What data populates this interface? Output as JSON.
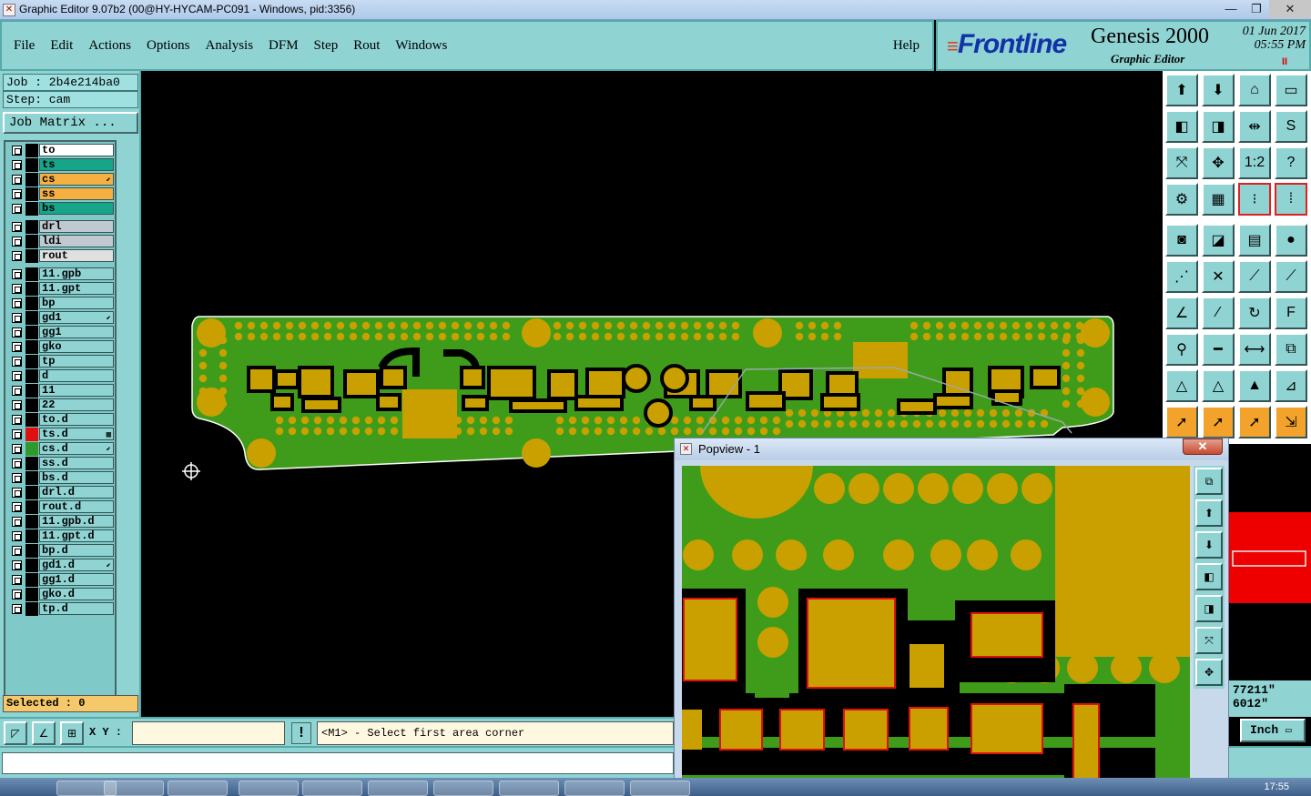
{
  "window": {
    "title": "Graphic Editor 9.07b2 (00@HY-HYCAM-PC091 - Windows, pid:3356)",
    "minimize": "—",
    "maximize": "❐",
    "close": "✕"
  },
  "menu": {
    "items": [
      "File",
      "Edit",
      "Actions",
      "Options",
      "Analysis",
      "DFM",
      "Step",
      "Rout",
      "Windows"
    ],
    "help": "Help"
  },
  "brand": {
    "logo": "Frontline",
    "product": "Genesis 2000",
    "subtitle": "Graphic Editor",
    "date": "01 Jun 2017",
    "time": "05:55 PM",
    "pause": "II"
  },
  "job": {
    "job_line": "Job : 2b4e214ba0",
    "step_line": "Step: cam",
    "matrix_button": "Job Matrix ..."
  },
  "layers": [
    {
      "name": "to",
      "color": "#ffffff",
      "swatch": "#000000",
      "mark": ""
    },
    {
      "name": "ts",
      "color": "#17a589",
      "swatch": "#000000",
      "mark": ""
    },
    {
      "name": "cs",
      "color": "#f5b041",
      "swatch": "#000000",
      "mark": "⬋"
    },
    {
      "name": "ss",
      "color": "#f5b041",
      "swatch": "#000000",
      "mark": ""
    },
    {
      "name": "bs",
      "color": "#17a589",
      "swatch": "#000000",
      "mark": ""
    },
    {
      "name": "drl",
      "color": "#c0c8d0",
      "swatch": "#000000",
      "mark": ""
    },
    {
      "name": "ldi",
      "color": "#c0c8d0",
      "swatch": "#000000",
      "mark": ""
    },
    {
      "name": "rout",
      "color": "#e0e0e0",
      "swatch": "#000000",
      "mark": ""
    },
    {
      "name": "11.gpb",
      "color": "#8fd3d3",
      "swatch": "#000000",
      "mark": ""
    },
    {
      "name": "11.gpt",
      "color": "#8fd3d3",
      "swatch": "#000000",
      "mark": ""
    },
    {
      "name": "bp",
      "color": "#8fd3d3",
      "swatch": "#000000",
      "mark": ""
    },
    {
      "name": "gd1",
      "color": "#8fd3d3",
      "swatch": "#000000",
      "mark": "⬋"
    },
    {
      "name": "gg1",
      "color": "#8fd3d3",
      "swatch": "#000000",
      "mark": ""
    },
    {
      "name": "gko",
      "color": "#8fd3d3",
      "swatch": "#000000",
      "mark": ""
    },
    {
      "name": "tp",
      "color": "#8fd3d3",
      "swatch": "#000000",
      "mark": ""
    },
    {
      "name": "d",
      "color": "#8fd3d3",
      "swatch": "#000000",
      "mark": ""
    },
    {
      "name": "11",
      "color": "#8fd3d3",
      "swatch": "#000000",
      "mark": ""
    },
    {
      "name": "22",
      "color": "#8fd3d3",
      "swatch": "#000000",
      "mark": ""
    },
    {
      "name": "to.d",
      "color": "#8fd3d3",
      "swatch": "#000000",
      "mark": ""
    },
    {
      "name": "ts.d",
      "color": "#8fd3d3",
      "swatch": "#e01010",
      "mark": "▦"
    },
    {
      "name": "cs.d",
      "color": "#8fd3d3",
      "swatch": "#2e9a2e",
      "mark": "⬋"
    },
    {
      "name": "ss.d",
      "color": "#8fd3d3",
      "swatch": "#000000",
      "mark": ""
    },
    {
      "name": "bs.d",
      "color": "#8fd3d3",
      "swatch": "#000000",
      "mark": ""
    },
    {
      "name": "drl.d",
      "color": "#8fd3d3",
      "swatch": "#000000",
      "mark": ""
    },
    {
      "name": "rout.d",
      "color": "#8fd3d3",
      "swatch": "#000000",
      "mark": ""
    },
    {
      "name": "11.gpb.d",
      "color": "#8fd3d3",
      "swatch": "#000000",
      "mark": ""
    },
    {
      "name": "11.gpt.d",
      "color": "#8fd3d3",
      "swatch": "#000000",
      "mark": ""
    },
    {
      "name": "bp.d",
      "color": "#8fd3d3",
      "swatch": "#000000",
      "mark": ""
    },
    {
      "name": "gd1.d",
      "color": "#8fd3d3",
      "swatch": "#000000",
      "mark": "⬋"
    },
    {
      "name": "gg1.d",
      "color": "#8fd3d3",
      "swatch": "#000000",
      "mark": ""
    },
    {
      "name": "gko.d",
      "color": "#8fd3d3",
      "swatch": "#000000",
      "mark": ""
    },
    {
      "name": "tp.d",
      "color": "#8fd3d3",
      "swatch": "#000000",
      "mark": ""
    }
  ],
  "selected": "Selected : 0",
  "status": {
    "xy_label": "X Y :",
    "xy_value": "",
    "bang": "!",
    "prompt": "<M1> - Select first area corner"
  },
  "coords": {
    "x": "77211\"",
    "y": "6012\""
  },
  "units": {
    "label": "Inch"
  },
  "popview": {
    "title": "Popview - 1",
    "close": "✕"
  },
  "taskbar": {
    "clock": "17:55"
  },
  "colors": {
    "panel": "#8fd3d3",
    "copper": "#c9a000",
    "mask": "#3f9c1a",
    "accent": "#f3a32c"
  },
  "tools": [
    {
      "icon": "display-layer-icon",
      "glyph": "⬆"
    },
    {
      "icon": "display-layer-down-icon",
      "glyph": "⬇"
    },
    {
      "icon": "home-icon",
      "glyph": "⌂"
    },
    {
      "icon": "split-view-icon",
      "glyph": "▭"
    },
    {
      "icon": "pan-left-icon",
      "glyph": "◧"
    },
    {
      "icon": "pan-right-icon",
      "glyph": "◨"
    },
    {
      "icon": "fit-width-icon",
      "glyph": "⇹"
    },
    {
      "icon": "rotate-icon",
      "glyph": "S"
    },
    {
      "icon": "zoom-fit-icon",
      "glyph": "⤧"
    },
    {
      "icon": "zoom-center-icon",
      "glyph": "✥"
    },
    {
      "icon": "scale-icon",
      "glyph": "1:2"
    },
    {
      "icon": "help-icon",
      "glyph": "?"
    },
    {
      "icon": "snap-icon",
      "glyph": "⚙"
    },
    {
      "icon": "grid-icon",
      "glyph": "▦"
    },
    {
      "icon": "layer-flags-icon",
      "glyph": "⁝"
    },
    {
      "icon": "layer-flags-alt-icon",
      "glyph": "⁞"
    },
    {
      "icon": "pad-icon",
      "glyph": "◙"
    },
    {
      "icon": "measure-color-icon",
      "glyph": "◪"
    },
    {
      "icon": "ruler-icon",
      "glyph": "▤"
    },
    {
      "icon": "circle-icon",
      "glyph": "●"
    },
    {
      "icon": "connect-icon",
      "glyph": "⋰"
    },
    {
      "icon": "delete-node-icon",
      "glyph": "✕"
    },
    {
      "icon": "line-edit-icon",
      "glyph": "⟋"
    },
    {
      "icon": "line-end-icon",
      "glyph": "⟋"
    },
    {
      "icon": "angle-icon",
      "glyph": "∠"
    },
    {
      "icon": "slash-icon",
      "glyph": "⁄"
    },
    {
      "icon": "arc-icon",
      "glyph": "↻"
    },
    {
      "icon": "text-icon",
      "glyph": "F"
    },
    {
      "icon": "measure-icon",
      "glyph": "⚲"
    },
    {
      "icon": "minus-icon",
      "glyph": "━"
    },
    {
      "icon": "resize-icon",
      "glyph": "⟷"
    },
    {
      "icon": "copy-icon",
      "glyph": "⧉"
    },
    {
      "icon": "triangle-icon",
      "glyph": "△"
    },
    {
      "icon": "triangle-alt-icon",
      "glyph": "△"
    },
    {
      "icon": "triangle-fill-icon",
      "glyph": "▲"
    },
    {
      "icon": "triangle-arrow-icon",
      "glyph": "⊿"
    },
    {
      "icon": "select-arrow-icon",
      "glyph": "➚"
    },
    {
      "icon": "select-plus-icon",
      "glyph": "➚"
    },
    {
      "icon": "select-circle-icon",
      "glyph": "➚"
    },
    {
      "icon": "select-multi-icon",
      "glyph": "⇲"
    }
  ],
  "popview_tools": [
    {
      "icon": "restore-icon",
      "glyph": "⧉"
    },
    {
      "icon": "up-icon",
      "glyph": "⬆"
    },
    {
      "icon": "down-icon",
      "glyph": "⬇"
    },
    {
      "icon": "left-icon",
      "glyph": "◧"
    },
    {
      "icon": "right-icon",
      "glyph": "◨"
    },
    {
      "icon": "fit-icon",
      "glyph": "⤧"
    },
    {
      "icon": "center-icon",
      "glyph": "✥"
    }
  ]
}
